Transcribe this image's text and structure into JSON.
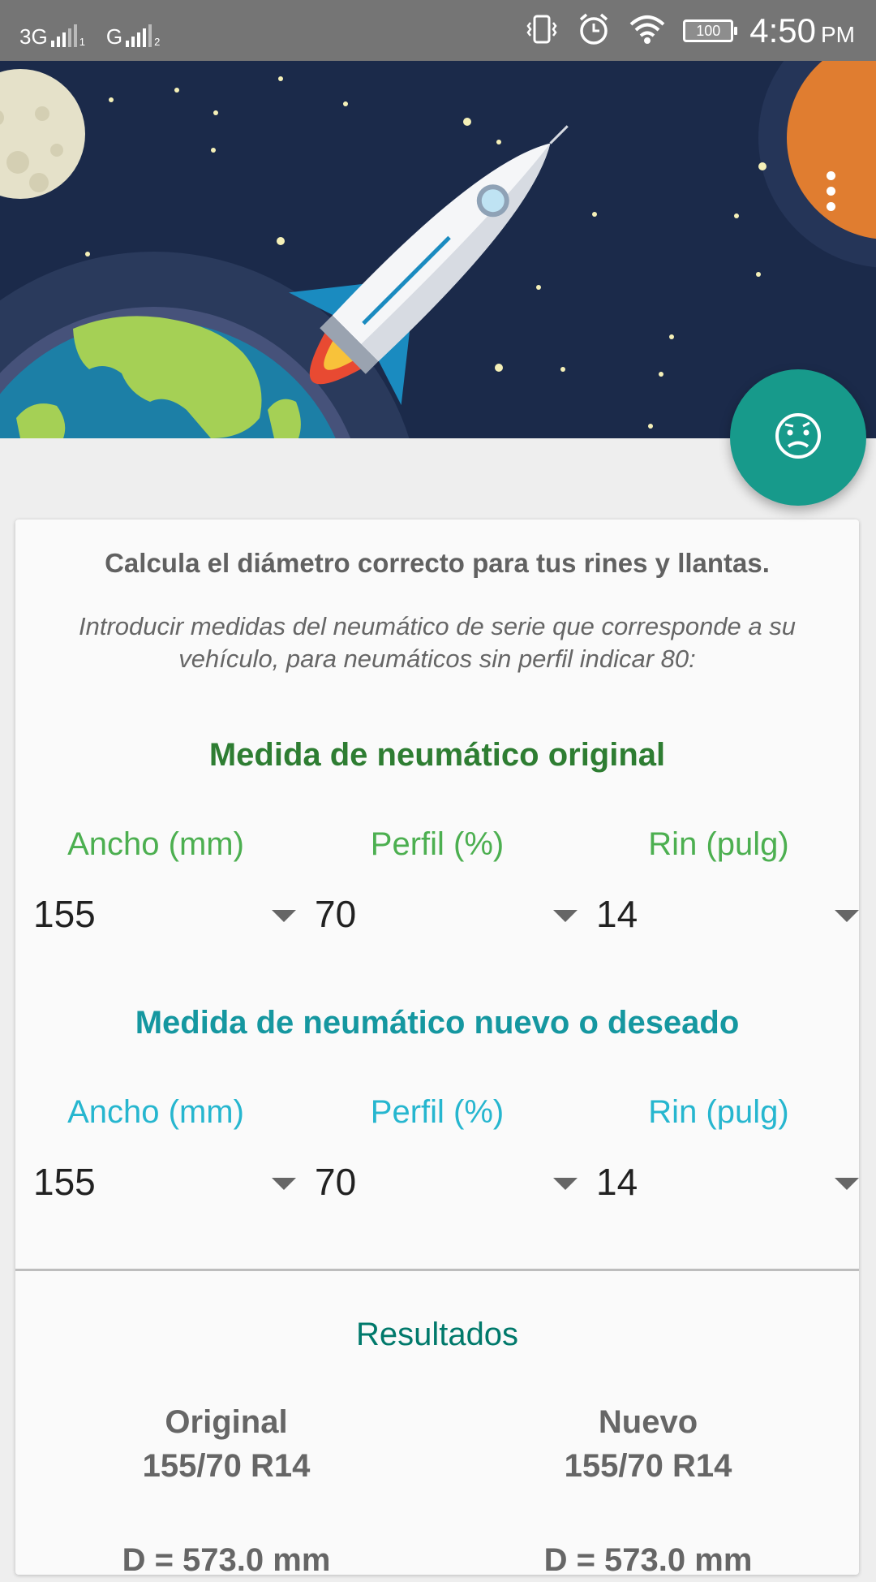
{
  "status_bar": {
    "network_1": "3G",
    "network_2": "G",
    "sim_1": "1",
    "sim_2": "2",
    "battery": "100",
    "time": "4:50",
    "ampm": "PM",
    "icons": [
      "vibrate-icon",
      "alarm-icon",
      "wifi-icon",
      "battery-icon"
    ]
  },
  "header": {
    "illustration": "space-rocket-illustration",
    "menu_icon": "more-vertical-icon"
  },
  "fab": {
    "icon": "confused-face-icon",
    "color": "#179a8b"
  },
  "card": {
    "title": "Calcula el diámetro correcto para tus rines y llantas.",
    "note": "Introducir medidas del neumático de serie que corresponde a su vehículo, para neumáticos sin perfil indicar 80:"
  },
  "original": {
    "title": "Medida de neumático original",
    "labels": [
      "Ancho (mm)",
      "Perfil (%)",
      "Rin (pulg)"
    ],
    "values": [
      "155",
      "70",
      "14"
    ]
  },
  "nuevo": {
    "title": "Medida de neumático nuevo o deseado",
    "labels": [
      "Ancho (mm)",
      "Perfil (%)",
      "Rin (pulg)"
    ],
    "values": [
      "155",
      "70",
      "14"
    ]
  },
  "results": {
    "title": "Resultados",
    "original": {
      "title": "Original",
      "size": "155/70 R14",
      "diameter": "D = 573.0 mm"
    },
    "nuevo": {
      "title": "Nuevo",
      "size": "155/70 R14",
      "diameter": "D = 573.0 mm"
    }
  },
  "colors": {
    "status_bar": "#757575",
    "header_bg": "#1b2a4a",
    "original_title": "#2e7d32",
    "original_label": "#4caf50",
    "nuevo_title": "#1597a0",
    "nuevo_label": "#26b6cf",
    "results_title": "#00796b"
  }
}
